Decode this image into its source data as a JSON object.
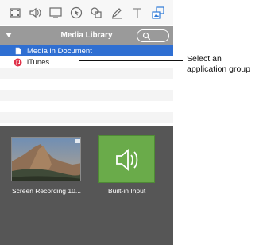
{
  "toolbar": {
    "icons": [
      "film-icon",
      "speaker-icon",
      "screen-icon",
      "cursor-icon",
      "shapes-icon",
      "pen-icon",
      "text-icon",
      "media-library-icon"
    ]
  },
  "library": {
    "title": "Media Library",
    "items": [
      {
        "label": "Media in Document",
        "icon": "document-icon",
        "selected": true
      },
      {
        "label": "iTunes",
        "icon": "itunes-icon",
        "selected": false
      }
    ]
  },
  "media": {
    "items": [
      {
        "label": "Screen Recording 10...",
        "kind": "video"
      },
      {
        "label": "Built-in Input",
        "kind": "audio"
      }
    ]
  },
  "callout": {
    "line1": "Select an",
    "line2": "application group"
  },
  "colors": {
    "selection": "#2f6fd2",
    "header": "#9a9a9a",
    "media_bg": "#565656",
    "audio_tile": "#6aab4a"
  }
}
